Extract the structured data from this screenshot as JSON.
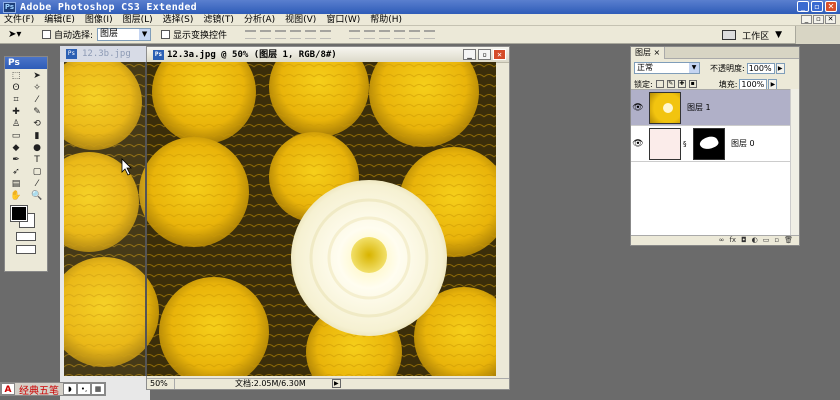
{
  "app": {
    "title": "Adobe Photoshop CS3 Extended",
    "logo": "Ps"
  },
  "menu": [
    "文件(F)",
    "编辑(E)",
    "图像(I)",
    "图层(L)",
    "选择(S)",
    "滤镜(T)",
    "分析(A)",
    "视图(V)",
    "窗口(W)",
    "帮助(H)"
  ],
  "options": {
    "auto_select_label": "自动选择:",
    "auto_select_value": "图层",
    "show_transform_label": "显示变换控件",
    "workspace_label": "工作区"
  },
  "toolbox": {
    "header": "Ps"
  },
  "documents": {
    "back_title": "12.3b.jpg",
    "front_title": "12.3a.jpg @ 50% (图层 1, RGB/8#)",
    "zoom": "50%",
    "doc_info": "文档:2.05M/6.30M"
  },
  "layers_panel": {
    "tab": "图层",
    "blend_mode": "正常",
    "opacity_label": "不透明度:",
    "opacity_value": "100%",
    "lock_label": "锁定:",
    "fill_label": "填充:",
    "fill_value": "100%",
    "layers": [
      {
        "name": "图层 1",
        "selected": true
      },
      {
        "name": "图层 0",
        "selected": false
      }
    ]
  },
  "ime": {
    "name": "经典五笔"
  },
  "colors": {
    "flower": "#f2c40f",
    "flower_dark": "#b8900a",
    "center_white": "#fffbe6"
  }
}
